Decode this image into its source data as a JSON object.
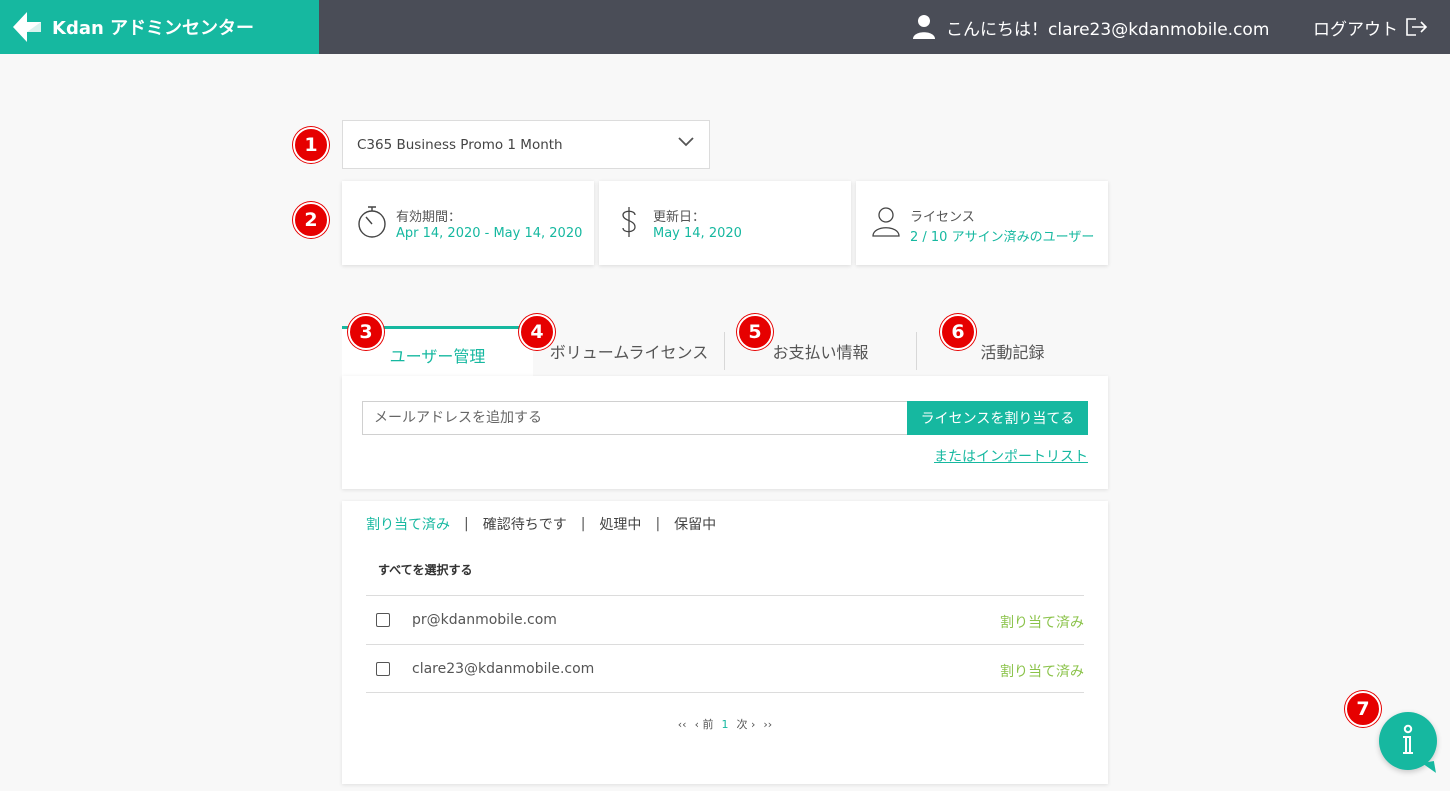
{
  "colors": {
    "accent": "#16b8a0",
    "header_bg": "#4a4d57",
    "status_green": "#8bc34a",
    "marker_red": "#e60000"
  },
  "header": {
    "brand_title": "Kdan アドミンセンター",
    "greeting": "こんにちは！clare23@kdanmobile.com",
    "logout_label": "ログアウト"
  },
  "markers": [
    "1",
    "2",
    "3",
    "4",
    "5",
    "6",
    "7"
  ],
  "plan_select": {
    "value": "C365 Business Promo 1 Month"
  },
  "cards": [
    {
      "icon": "stopwatch-icon",
      "label": "有効期間：",
      "value": "Apr 14, 2020 - May 14, 2020"
    },
    {
      "icon": "dollar-icon",
      "label": "更新日：",
      "value": "May 14, 2020"
    },
    {
      "icon": "user-icon",
      "label": "ライセンス",
      "value": "2 / 10 アサイン済みのユーザー"
    }
  ],
  "tabs": [
    {
      "label": "ユーザー管理",
      "active": true
    },
    {
      "label": "ボリュームライセンス",
      "active": false
    },
    {
      "label": "お支払い情報",
      "active": false
    },
    {
      "label": "活動記録",
      "active": false
    }
  ],
  "assign": {
    "email_placeholder": "メールアドレスを追加する",
    "assign_button": "ライセンスを割り当てる",
    "import_link": "またはインポートリスト"
  },
  "users": {
    "filters": [
      "割り当て済み",
      "確認待ちです",
      "処理中",
      "保留中"
    ],
    "select_all": "すべてを選択する",
    "rows": [
      {
        "email": "pr@kdanmobile.com",
        "status": "割り当て済み"
      },
      {
        "email": "clare23@kdanmobile.com",
        "status": "割り当て済み"
      }
    ],
    "pager": {
      "first": "‹‹",
      "prev": "‹ 前",
      "current": "1",
      "next": "次 ›",
      "last": "››"
    }
  }
}
